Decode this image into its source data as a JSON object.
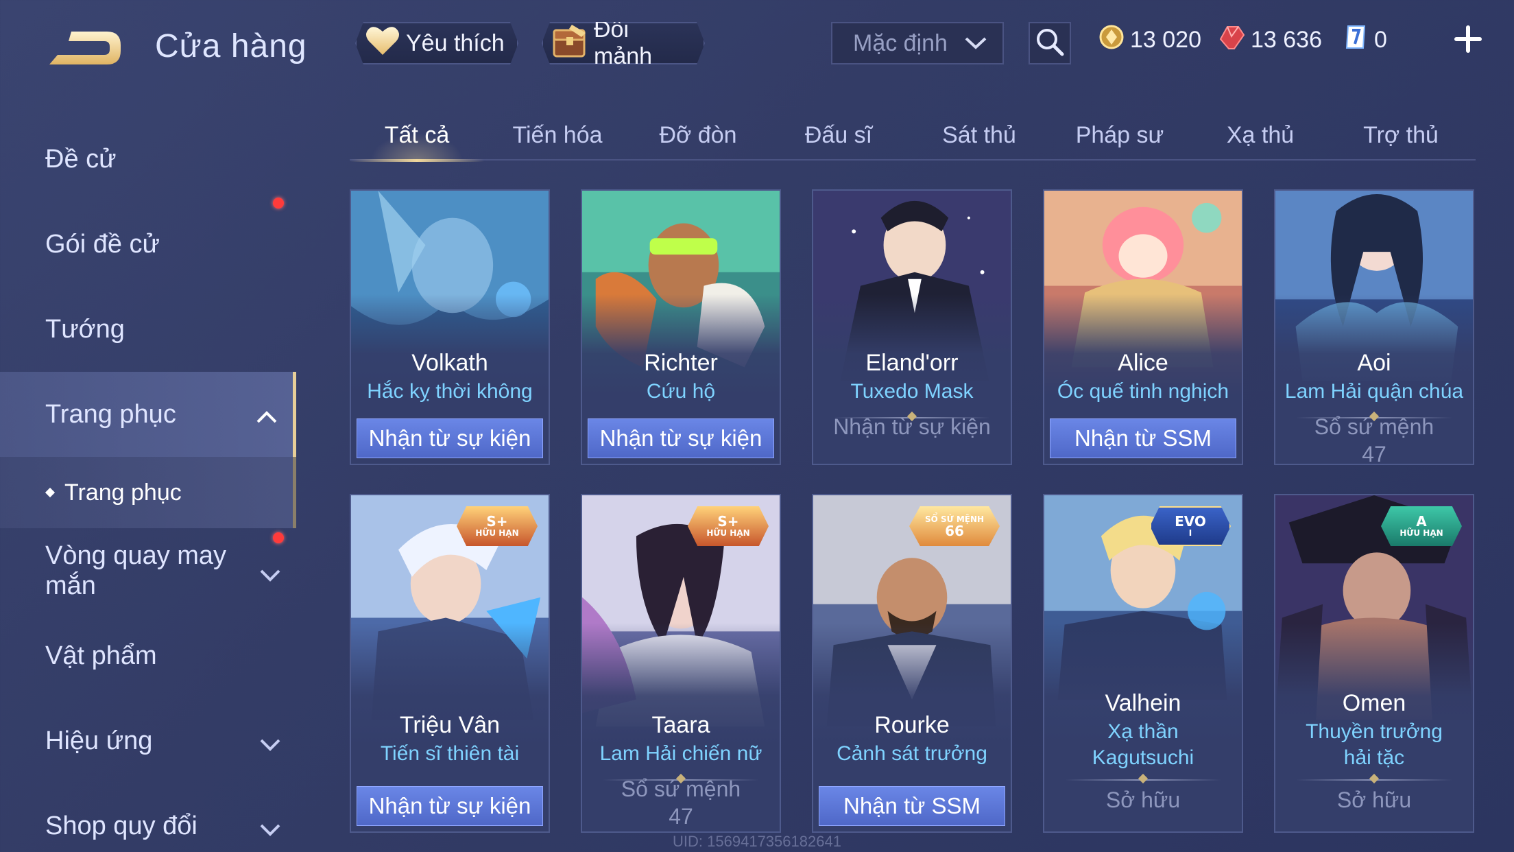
{
  "header": {
    "title": "Cửa hàng",
    "favorite_label": "Yêu thích",
    "swap_label": "Đổi mảnh",
    "sort_value": "Mặc định",
    "currencies": {
      "gold": "13 020",
      "ruby": "13 636",
      "voucher": "0"
    }
  },
  "sidebar": {
    "items": [
      {
        "label": "Đề cử"
      },
      {
        "label": "Gói đề cử"
      },
      {
        "label": "Tướng"
      },
      {
        "label": "Trang phục"
      },
      {
        "label": "Vòng quay may mắn"
      },
      {
        "label": "Vật phẩm"
      },
      {
        "label": "Hiệu ứng"
      },
      {
        "label": "Shop quy đổi"
      }
    ],
    "sub_items": [
      {
        "label": "Trang phục"
      }
    ]
  },
  "tabs": [
    "Tất cả",
    "Tiến hóa",
    "Đỡ đòn",
    "Đấu sĩ",
    "Sát thủ",
    "Pháp sư",
    "Xạ thủ",
    "Trợ thủ"
  ],
  "cards": [
    {
      "hero": "Volkath",
      "skin": "Hắc kỵ thời không",
      "action": "Nhận từ sự kiện"
    },
    {
      "hero": "Richter",
      "skin": "Cứu hộ",
      "action": "Nhận từ sự kiện"
    },
    {
      "hero": "Eland'orr",
      "skin": "Tuxedo Mask",
      "status": "Nhận từ sự kiện"
    },
    {
      "hero": "Alice",
      "skin": "Óc quế tinh nghịch",
      "action": "Nhận từ SSM"
    },
    {
      "hero": "Aoi",
      "skin": "Lam Hải quận chúa",
      "status": "Sổ sứ mệnh 47"
    },
    {
      "hero": "Triệu Vân",
      "skin": "Tiến sĩ thiên tài",
      "action": "Nhận từ sự kiện",
      "badge_top": "S+",
      "badge_bottom": "HỮU HẠN"
    },
    {
      "hero": "Taara",
      "skin": "Lam Hải chiến nữ",
      "status": "Sổ sứ mệnh 47",
      "badge_top": "S+",
      "badge_bottom": "HỮU HẠN"
    },
    {
      "hero": "Rourke",
      "skin": "Cảnh sát trưởng",
      "action": "Nhận từ SSM",
      "badge_top": "66",
      "badge_bottom": "SỔ SỨ MỆNH"
    },
    {
      "hero": "Valhein",
      "skin": "Xạ thần Kagutsuchi",
      "status": "Sở hữu",
      "badge_top": "EVO",
      "badge_bottom": "I"
    },
    {
      "hero": "Omen",
      "skin": "Thuyền trưởng hải tặc",
      "status": "Sở hữu",
      "badge_top": "A",
      "badge_bottom": "HỮU HẠN"
    }
  ],
  "footer": {
    "uid": "UID: 1569417356182641"
  },
  "colors": {
    "accent_gold": "#f0d79c",
    "skin_name": "#7fd3ff",
    "action_button": "#5a74d6",
    "notification": "#ff3b3b"
  }
}
